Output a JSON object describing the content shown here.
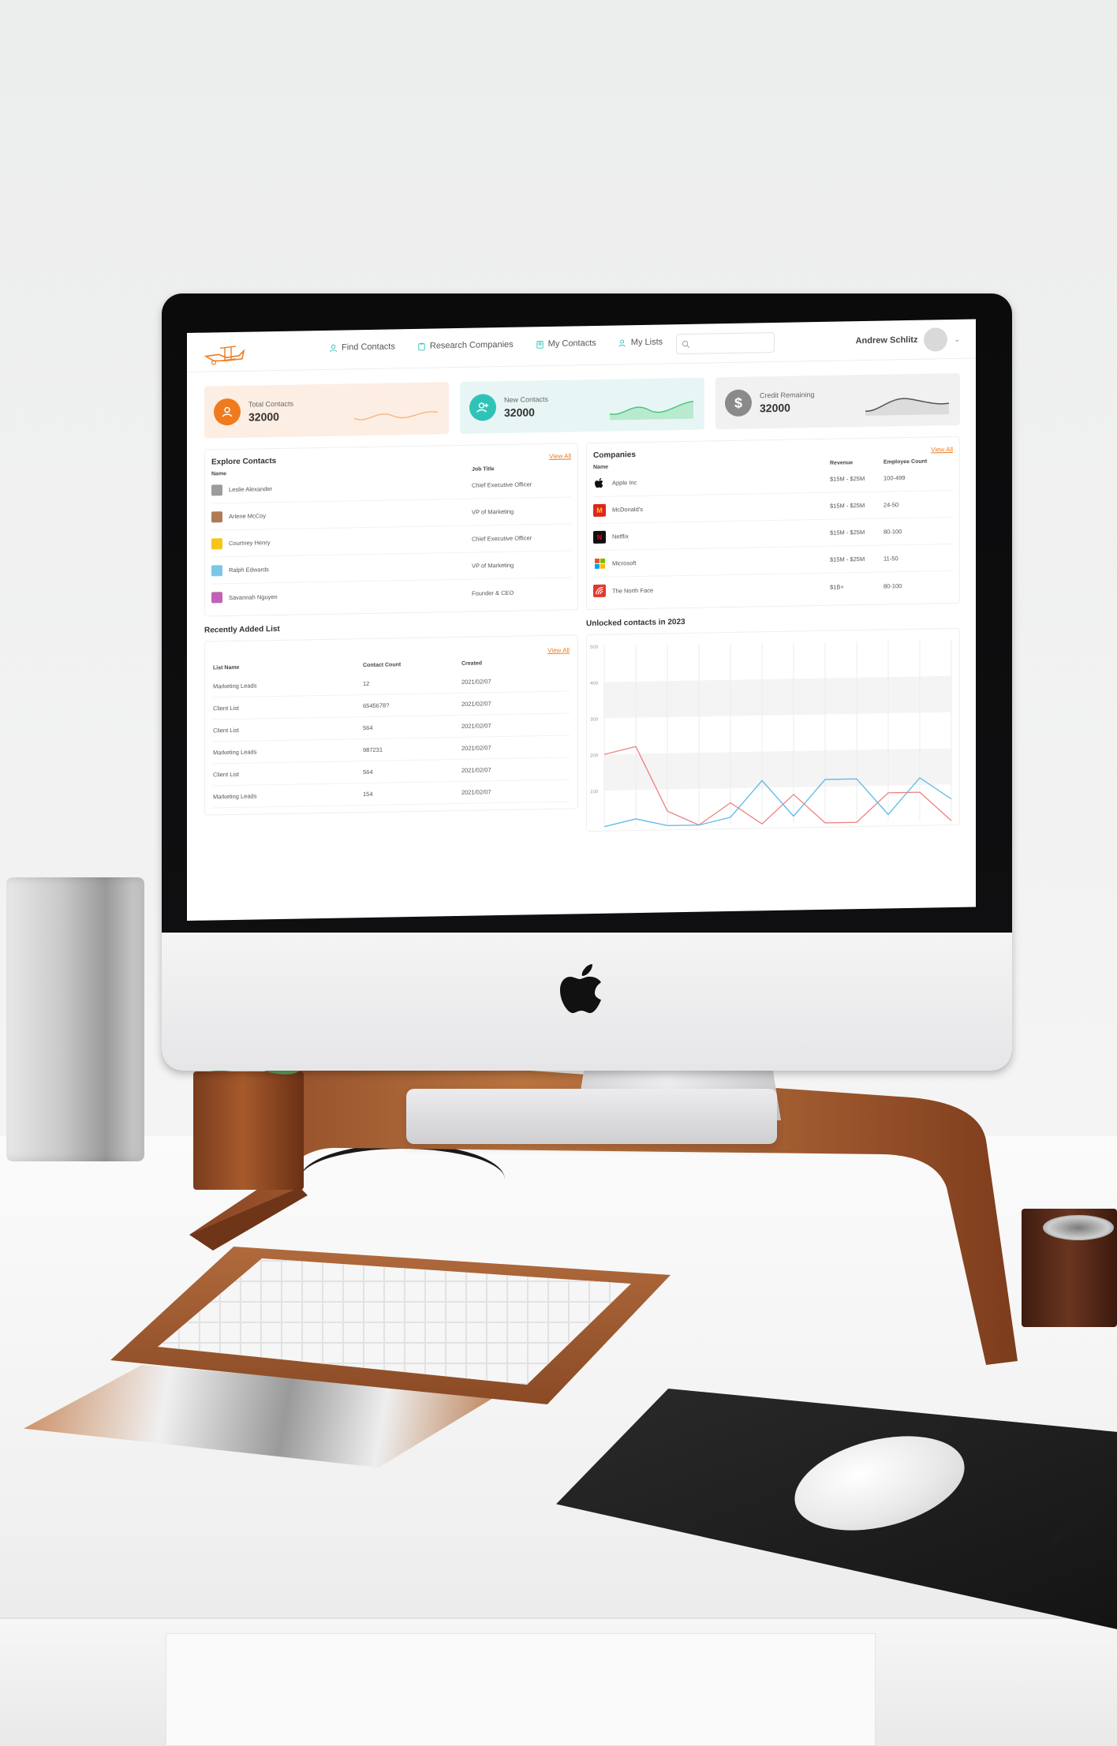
{
  "app": {
    "nav": [
      {
        "label": "Find Contacts",
        "icon": "user-icon"
      },
      {
        "label": "Research Companies",
        "icon": "clipboard-icon"
      },
      {
        "label": "My Contacts",
        "icon": "contacts-icon"
      },
      {
        "label": "My Lists",
        "icon": "users-icon"
      }
    ],
    "search": {
      "placeholder": ""
    },
    "user": {
      "name": "Andrew Schlitz"
    }
  },
  "stats": [
    {
      "label": "Total Contacts",
      "value": "32000",
      "color": "#f07b1f",
      "bg": "#fdeee3"
    },
    {
      "label": "New Contacts",
      "value": "32000",
      "color": "#2fc3b8",
      "bg": "#e7f6f5"
    },
    {
      "label": "Credit Remaining",
      "value": "32000",
      "color": "#8a8a8a",
      "bg": "#f1f1f1"
    }
  ],
  "explore": {
    "title": "Explore Contacts",
    "view_all": "View All",
    "columns": [
      "Name",
      "Job Title"
    ],
    "rows": [
      {
        "name": "Leslie Alexander",
        "title": "Chief Executive Officer",
        "color": "#9c9c9c"
      },
      {
        "name": "Arlene McCoy",
        "title": "VP of Marketing",
        "color": "#b07a55"
      },
      {
        "name": "Courtney Henry",
        "title": "Chief Executive Officer",
        "color": "#f5c518"
      },
      {
        "name": "Ralph Edwards",
        "title": "VP of Marketing",
        "color": "#7cc7e8"
      },
      {
        "name": "Savannah Nguyen",
        "title": "Founder & CEO",
        "color": "#c062b8"
      }
    ]
  },
  "companies": {
    "title": "Companies",
    "view_all": "View All",
    "columns": [
      "Name",
      "Revenue",
      "Employee Count"
    ],
    "rows": [
      {
        "name": "Apple Inc",
        "revenue": "$15M - $25M",
        "employees": "100-499",
        "logo": "apple-logo-icon",
        "color": "#111111",
        "glyph": ""
      },
      {
        "name": "McDonald's",
        "revenue": "$15M - $25M",
        "employees": "24-50",
        "logo": "mcdonalds-logo-icon",
        "color": "#da291c",
        "glyph": "M"
      },
      {
        "name": "Netflix",
        "revenue": "$15M - $25M",
        "employees": "80-100",
        "logo": "netflix-logo-icon",
        "color": "#111111",
        "glyph": "N"
      },
      {
        "name": "Microsoft",
        "revenue": "$15M - $25M",
        "employees": "11-50",
        "logo": "microsoft-logo-icon",
        "color": "#ffffff",
        "glyph": ""
      },
      {
        "name": "The North Face",
        "revenue": "$1B+",
        "employees": "80-100",
        "logo": "northface-logo-icon",
        "color": "#e03a2f",
        "glyph": ""
      }
    ]
  },
  "recent": {
    "title": "Recently Added List",
    "view_all": "View All",
    "columns": [
      "List Name",
      "Contact Count",
      "Created"
    ],
    "rows": [
      {
        "name": "Marketing Leads",
        "count": "12",
        "created": "2021/02/07"
      },
      {
        "name": "Client List",
        "count": "6545678?",
        "created": "2021/02/07"
      },
      {
        "name": "Client List",
        "count": "564",
        "created": "2021/02/07"
      },
      {
        "name": "Marketing Leads",
        "count": "987231",
        "created": "2021/02/07"
      },
      {
        "name": "Client List",
        "count": "564",
        "created": "2021/02/07"
      },
      {
        "name": "Marketing Leads",
        "count": "154",
        "created": "2021/02/07"
      }
    ]
  },
  "chart_data": {
    "type": "line",
    "title": "Unlocked contacts in 2023",
    "yticks": [
      "500",
      "400",
      "300",
      "200",
      "100"
    ],
    "ylim": [
      0,
      500
    ],
    "x": [
      0,
      1,
      2,
      3,
      4,
      5,
      6,
      7,
      8,
      9,
      10,
      11
    ],
    "series": [
      {
        "color": "#f08080",
        "values": [
          200,
          220,
          40,
          0,
          60,
          0,
          80,
          0,
          0,
          80,
          80,
          0
        ]
      },
      {
        "color": "#5bb8e8",
        "values": [
          0,
          20,
          0,
          0,
          20,
          120,
          20,
          120,
          120,
          20,
          120,
          60
        ]
      }
    ],
    "grid": true
  }
}
